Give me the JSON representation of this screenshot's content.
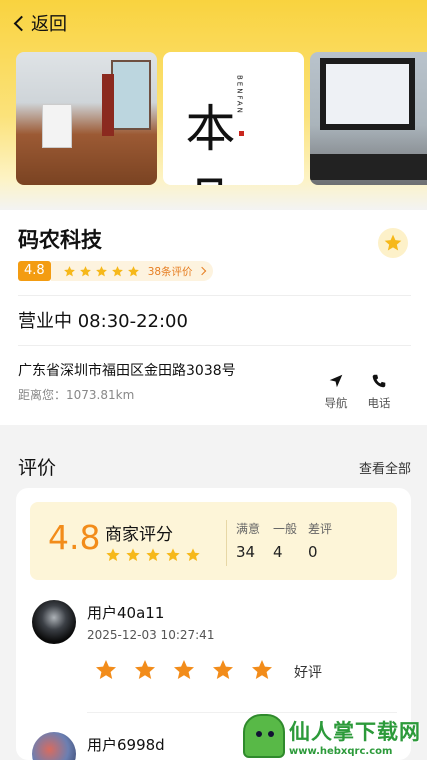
{
  "header": {
    "back_label": "返回"
  },
  "gallery": [
    {
      "name": "office-photo"
    },
    {
      "name": "brand-logo",
      "logo_text": "本凡",
      "logo_sub": "BENFAN"
    },
    {
      "name": "desk-photo"
    }
  ],
  "shop": {
    "name": "码农科技",
    "score": "4.8",
    "stars": 5,
    "review_count_label": "38条评价",
    "hours": "营业中 08:30-22:00",
    "address": "广东省深圳市福田区金田路3038号",
    "distance": "距离您：1073.81km",
    "actions": {
      "nav": "导航",
      "phone": "电话"
    }
  },
  "reviews": {
    "title": "评价",
    "see_all": "查看全部",
    "summary": {
      "score": "4.8",
      "label": "商家评分",
      "stars": 5,
      "stats": [
        {
          "label": "满意",
          "value": "34"
        },
        {
          "label": "一般",
          "value": "4"
        },
        {
          "label": "差评",
          "value": "0"
        }
      ]
    },
    "items": [
      {
        "user": "用户40a11",
        "time": "2025-12-03 10:27:41",
        "stars": 5,
        "label": "好评"
      },
      {
        "user": "用户6998d"
      }
    ]
  },
  "watermark": {
    "title": "仙人掌下载网",
    "url": "www.hebxqrc.com"
  },
  "colors": {
    "accent": "#f28c1a",
    "header_yellow": "#f9d33f",
    "star": "#f6b81a"
  }
}
